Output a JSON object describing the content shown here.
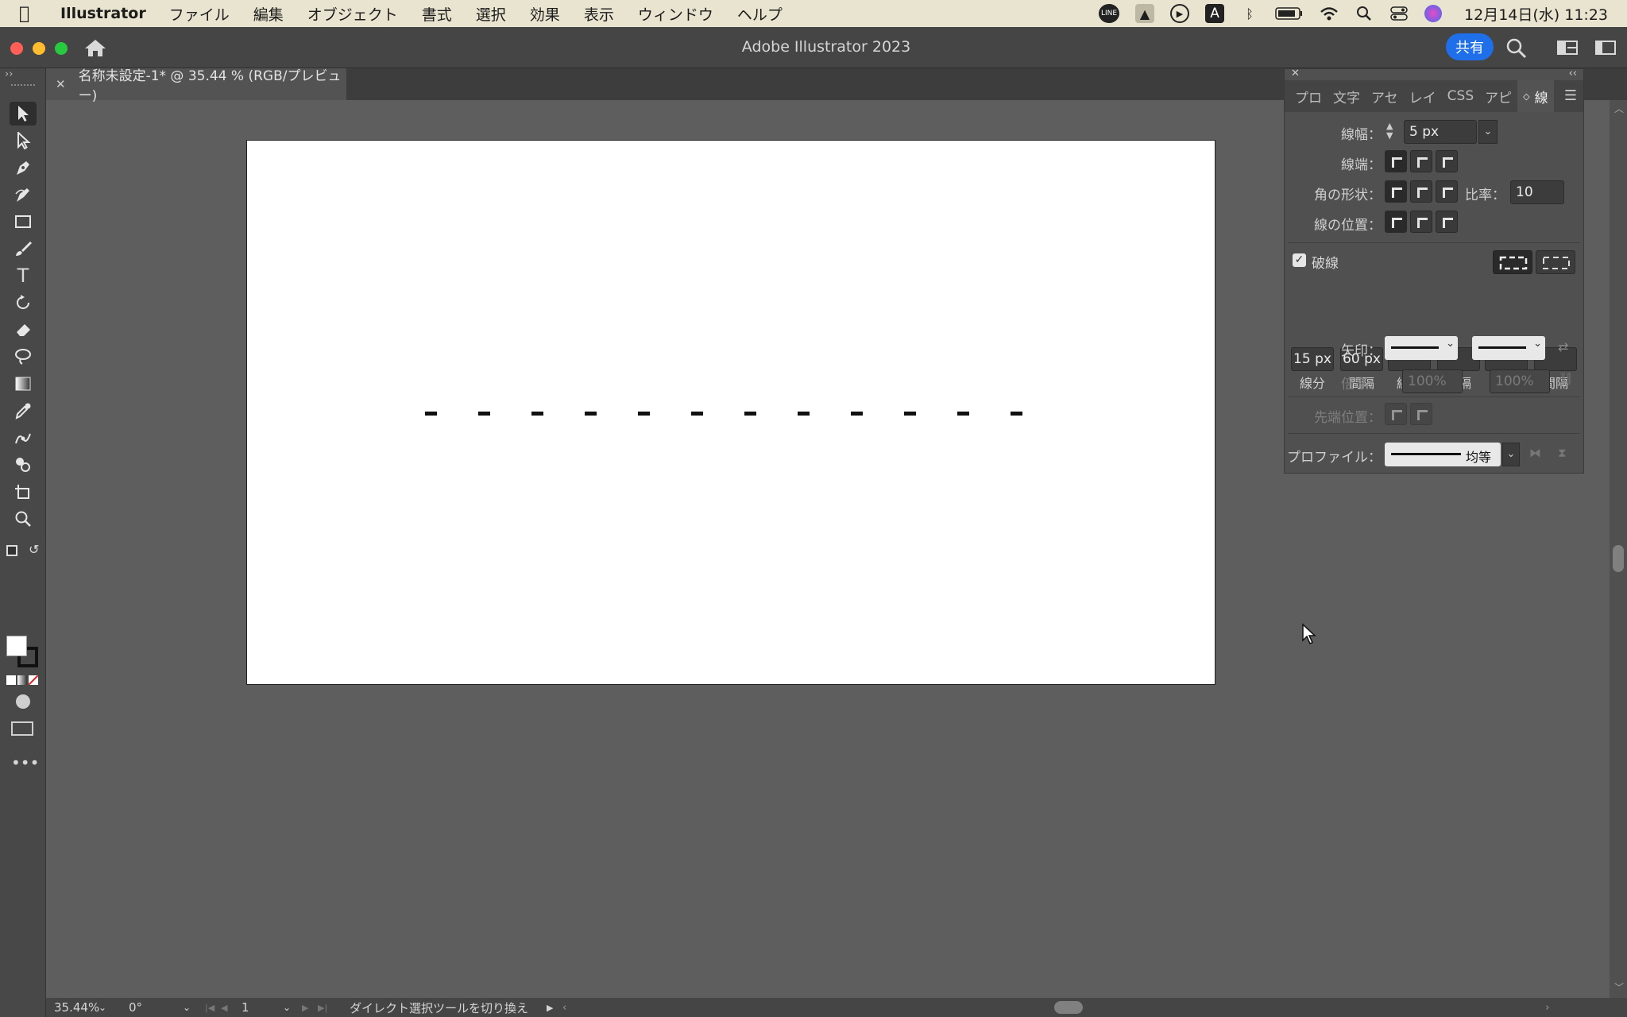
{
  "menubar": {
    "app_name": "Illustrator",
    "items": [
      "ファイル",
      "編集",
      "オブジェクト",
      "書式",
      "選択",
      "効果",
      "表示",
      "ウィンドウ",
      "ヘルプ"
    ],
    "status_icons": [
      "line-icon",
      "drive-icon",
      "play-icon",
      "input-icon",
      "bluetooth-icon",
      "battery-icon",
      "wifi-icon",
      "search-icon",
      "control-center-icon",
      "siri-icon"
    ],
    "input_indicator": "A",
    "clock": "12月14日(水) 11:23"
  },
  "window": {
    "title": "Adobe Illustrator 2023",
    "share_label": "共有",
    "doc_tab": "名称未設定-1* @ 35.44 % (RGB/プレビュー)"
  },
  "tools": [
    "selection-tool",
    "direct-selection-tool",
    "pen-tool",
    "curvature-tool",
    "rectangle-tool",
    "paintbrush-tool",
    "type-tool",
    "rotate-tool",
    "eraser-tool",
    "lasso-tool",
    "gradient-tool",
    "eyedropper-tool",
    "puppet-warp-tool",
    "shape-builder-tool",
    "artboard-tool",
    "zoom-tool"
  ],
  "stroke_panel": {
    "tabs": [
      "プロ",
      "文字",
      "アセ",
      "レイ",
      "CSS",
      "アピ",
      "線"
    ],
    "weight_label": "線幅：",
    "weight_value": "5 px",
    "cap_label": "線端：",
    "corner_label": "角の形状：",
    "limit_label": "比率：",
    "limit_value": "10",
    "align_label": "線の位置：",
    "dashed_label": "破線",
    "dash_values": [
      "15 px",
      "60 px",
      "",
      "",
      "",
      ""
    ],
    "dash_labels": [
      "線分",
      "間隔",
      "線分",
      "間隔",
      "線分",
      "間隔"
    ],
    "arrow_label": "矢印：",
    "scale_label": "倍率：",
    "scale_values": [
      "100%",
      "100%"
    ],
    "tip_label": "先端位置：",
    "profile_label": "プロファイル：",
    "profile_value": "均等"
  },
  "canvas": {
    "dash_count": 12,
    "stroke_color": "#111111"
  },
  "statusbar": {
    "zoom": "35.44%",
    "rotation": "0°",
    "artboard_num": "1",
    "message": "ダイレクト選択ツールを切り換え"
  }
}
